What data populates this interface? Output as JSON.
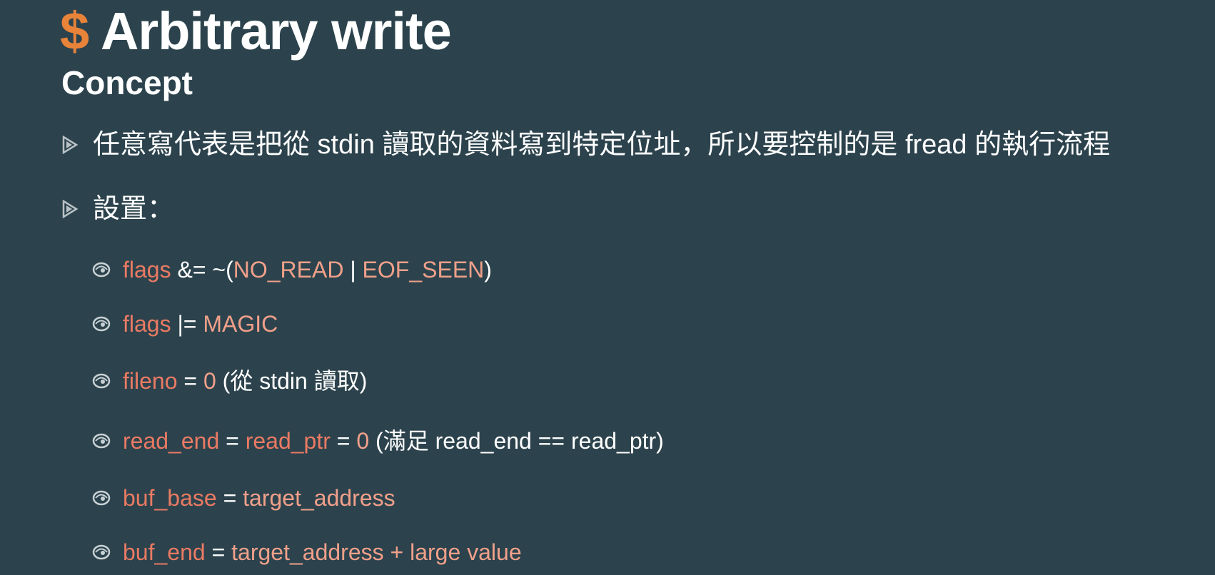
{
  "slide": {
    "title_prefix": "$",
    "title": " Arbitrary write",
    "subtitle": "Concept"
  },
  "bullets": {
    "b1": "任意寫代表是把從 stdin 讀取的資料寫到特定位址，所以要控制的是 fread 的執行流程",
    "b2": "設置："
  },
  "items": [
    {
      "parts": [
        "flags",
        " &= ~(",
        "NO_READ",
        " | ",
        "EOF_SEEN",
        ")"
      ]
    },
    {
      "parts": [
        "flags",
        " |= ",
        "MAGIC"
      ]
    },
    {
      "parts": [
        "fileno",
        " = ",
        "0",
        " (從 stdin 讀取)"
      ]
    },
    {
      "parts": [
        "read_end",
        " = ",
        "read_ptr",
        " = ",
        "0",
        " (滿足 read_end == read_ptr)"
      ]
    },
    {
      "parts": [
        "buf_base",
        " = ",
        "target_address"
      ]
    },
    {
      "parts": [
        "buf_end",
        " = ",
        "target_address + large value"
      ]
    }
  ],
  "colors": {
    "background": "#2c434d",
    "accent_orange": "#e8833a",
    "code_highlight": "#ea7a63",
    "code_value": "#f1a08a",
    "text": "#ffffff"
  },
  "icons": {
    "level1_bullet": "triangle-arrow-icon",
    "level2_bullet": "swirl-icon"
  }
}
